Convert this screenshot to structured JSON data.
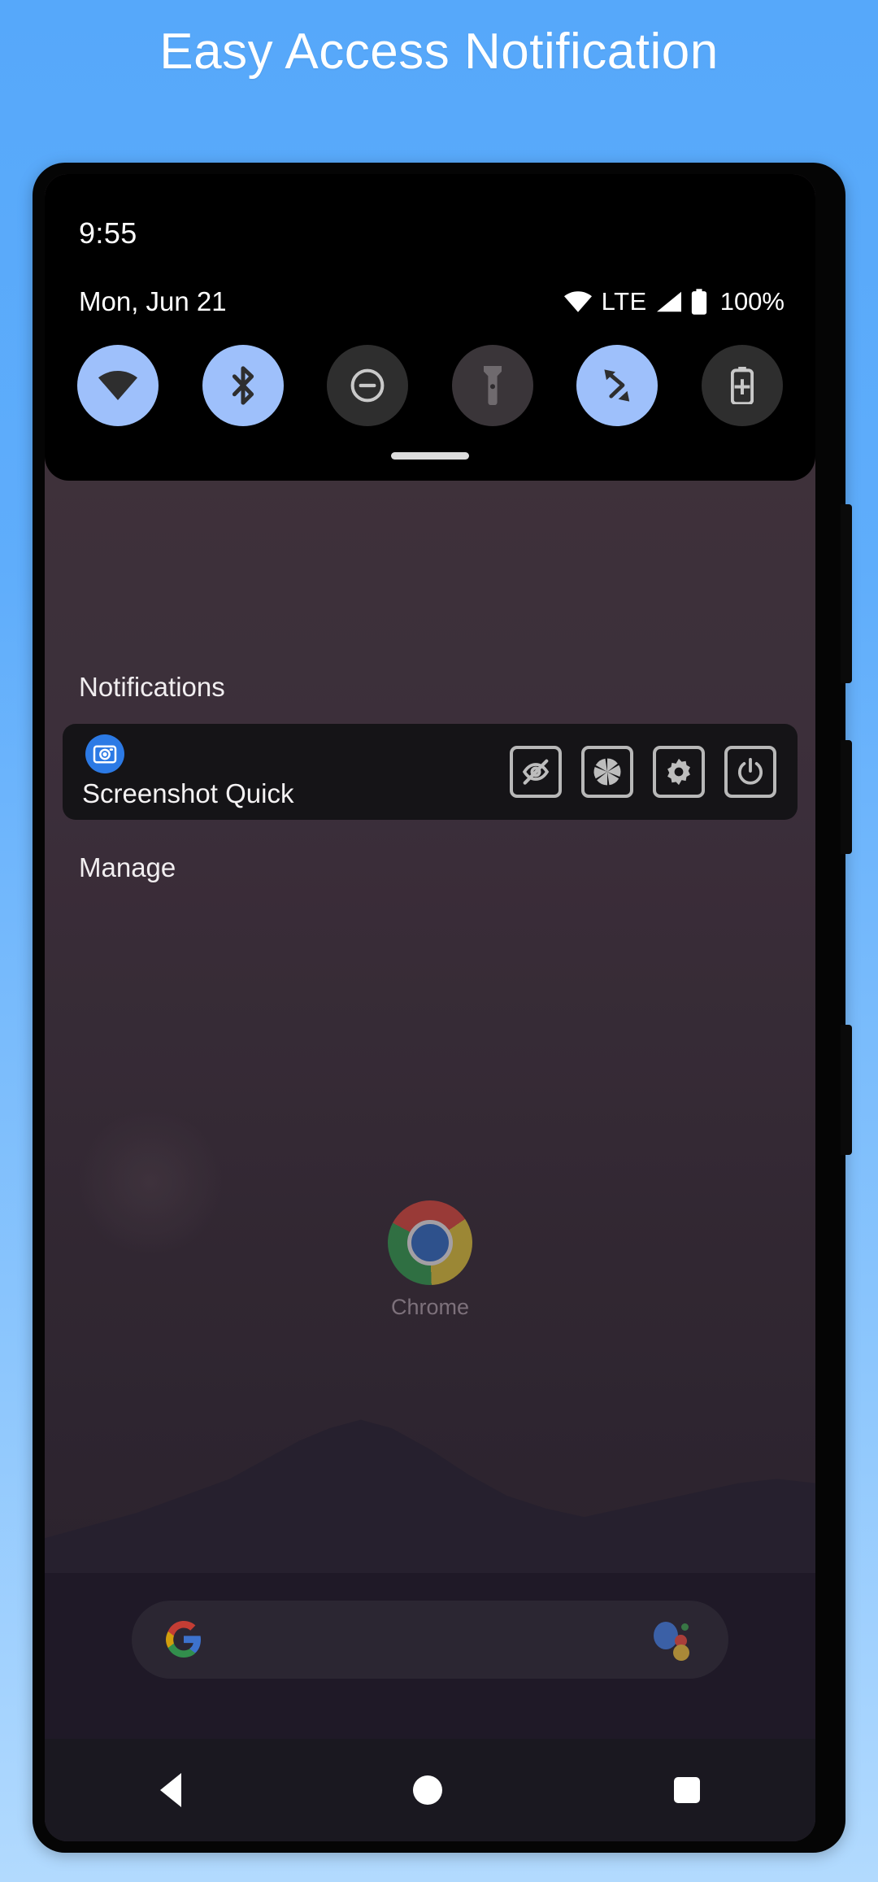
{
  "header": {
    "title": "Easy Access Notification"
  },
  "statusbar": {
    "clock": "9:55",
    "date": "Mon, Jun 21",
    "network_type": "LTE",
    "battery_percent": "100%",
    "icons": [
      "wifi-icon",
      "signal-icon",
      "battery-icon"
    ]
  },
  "quick_settings": {
    "tiles": [
      {
        "name": "wifi",
        "icon": "wifi-icon",
        "state": "on"
      },
      {
        "name": "bluetooth",
        "icon": "bluetooth-icon",
        "state": "on"
      },
      {
        "name": "do-not-disturb",
        "icon": "do-not-disturb-icon",
        "state": "off"
      },
      {
        "name": "flashlight",
        "icon": "flashlight-icon",
        "state": "off"
      },
      {
        "name": "auto-rotate",
        "icon": "auto-rotate-icon",
        "state": "on"
      },
      {
        "name": "battery-saver",
        "icon": "battery-saver-icon",
        "state": "off"
      }
    ],
    "colors": {
      "on": "#9ec0fb",
      "off": "#2e2e2e",
      "glyph_on": "#2e2e2e",
      "glyph_off": "#bdbdbd"
    }
  },
  "notifications": {
    "section_label": "Notifications",
    "manage_label": "Manage",
    "items": [
      {
        "app_icon": "camera-icon",
        "app_icon_color": "#2c7ae5",
        "title": "Screenshot Quick",
        "actions": [
          {
            "name": "hide",
            "icon": "eye-off-icon"
          },
          {
            "name": "capture",
            "icon": "aperture-icon"
          },
          {
            "name": "settings",
            "icon": "gear-icon"
          },
          {
            "name": "power",
            "icon": "power-icon"
          }
        ]
      }
    ]
  },
  "homescreen": {
    "app": {
      "label": "Chrome",
      "icon": "chrome-icon"
    },
    "search": {
      "left_icon": "google-g-icon",
      "right_icon": "assistant-icon"
    }
  },
  "navbar": {
    "buttons": [
      {
        "name": "back",
        "icon": "back-triangle-icon"
      },
      {
        "name": "home",
        "icon": "home-circle-icon"
      },
      {
        "name": "recents",
        "icon": "recents-square-icon"
      }
    ]
  }
}
